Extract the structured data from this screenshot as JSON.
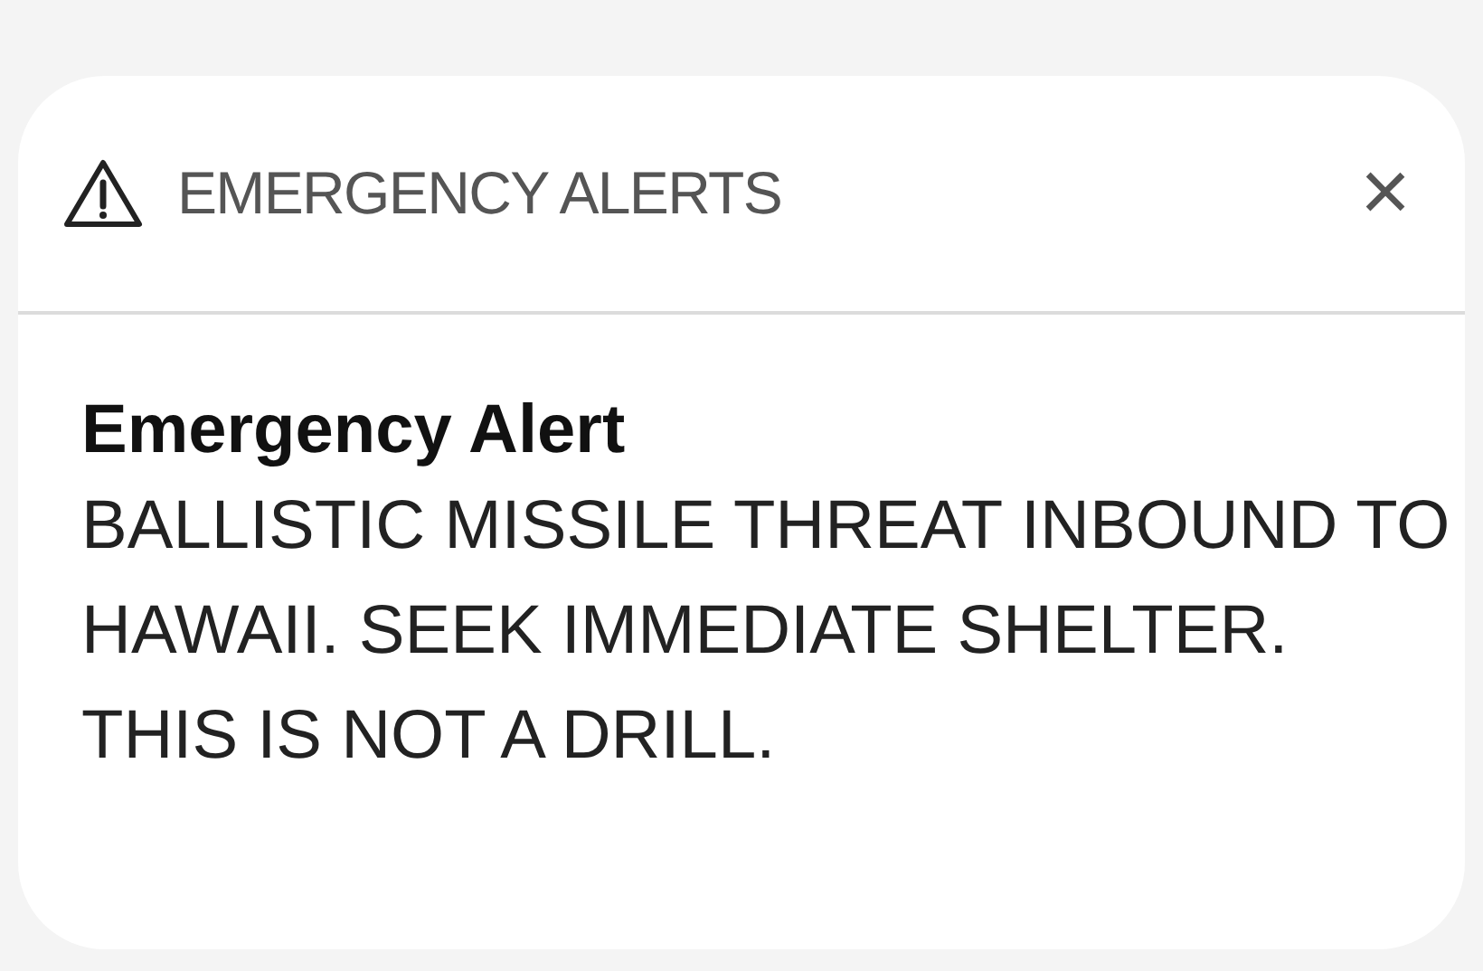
{
  "header": {
    "title": "EMERGENCY ALERTS",
    "close": "×"
  },
  "alert": {
    "title": "Emergency Alert",
    "message": "BALLISTIC MISSILE THREAT INBOUND TO HAWAII. SEEK IMMEDIATE SHELTER. THIS IS NOT A DRILL."
  }
}
